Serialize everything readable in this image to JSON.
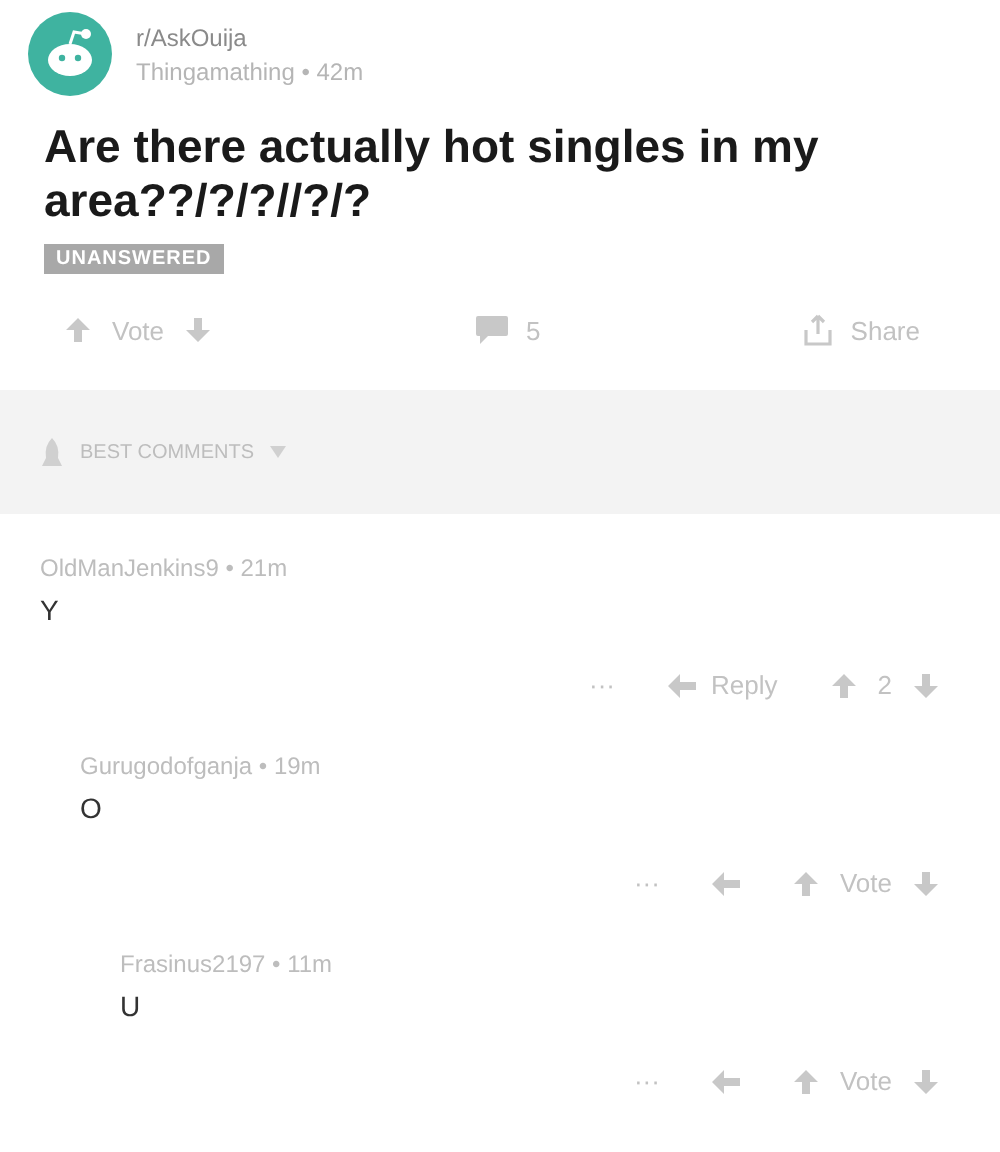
{
  "post": {
    "subreddit": "r/AskOuija",
    "byline": "Thingamathing • 42m",
    "title": "Are there actually hot singles in my area??/?/?//?/?",
    "flair": "UNANSWERED",
    "vote_label": "Vote",
    "comment_count": "5",
    "share_label": "Share"
  },
  "sort": {
    "label": "BEST COMMENTS"
  },
  "comments": [
    {
      "author": "OldManJenkins9 • 21m",
      "body": "Y",
      "more": "···",
      "reply_label": "Reply",
      "score": "2",
      "children": [
        {
          "author": "Gurugodofganja • 19m",
          "body": "O",
          "more": "···",
          "score": "Vote",
          "children": [
            {
              "author": "Frasinus2197 • 11m",
              "body": "U",
              "more": "···",
              "score": "Vote"
            }
          ]
        }
      ]
    }
  ]
}
